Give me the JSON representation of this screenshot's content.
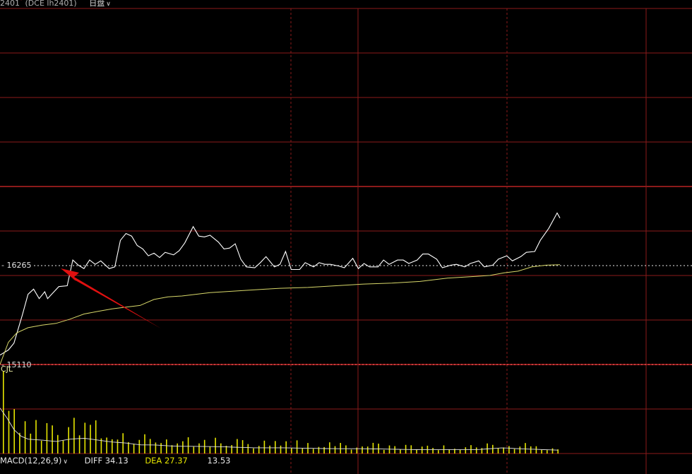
{
  "header": {
    "symbol_text": "2401",
    "star": "*",
    "contract_text": "(DCE lh2401)",
    "period_label": "日盘",
    "period_chevron": "chevron-down-icon"
  },
  "price_axis": {
    "upper_ref_label": "16265",
    "lower_ref_label": "15110"
  },
  "volume_panel": {
    "label": "CJL"
  },
  "macd": {
    "name": "MACD(12,26,9)",
    "chevron": "chevron-down-icon",
    "diff_label": "DIFF 34.13",
    "dea_label": "DEA 27.37",
    "macd_value": "13.53"
  },
  "colors": {
    "background": "#000000",
    "grid": "#8b1a1a",
    "price_line": "#ffffff",
    "avg_line": "#d8d86a",
    "ref_line_upper": "#e8e8e8",
    "ref_line_lower": "#ff6060",
    "volume_bar": "#e6e600",
    "annotation_arrow": "#e01010",
    "dea_text": "#e6e600"
  },
  "chart_data": {
    "type": "line",
    "panels": [
      "price",
      "volume",
      "macd"
    ],
    "price_range": [
      14980,
      17520
    ],
    "reference_lines": [
      16265,
      15110
    ],
    "series": [
      {
        "role": "price",
        "x": [
          0,
          3,
          5,
          8,
          10,
          12,
          14,
          16,
          17,
          19,
          21,
          24,
          26,
          28,
          30,
          32,
          34,
          36,
          39,
          41,
          43,
          45,
          47,
          49,
          51,
          53,
          55,
          57,
          59,
          62,
          64,
          66,
          69,
          71,
          73,
          75,
          78,
          80,
          82,
          84,
          86,
          88,
          91,
          93,
          95,
          98,
          100,
          102,
          104,
          107,
          109,
          112,
          114,
          116,
          118,
          121,
          123,
          126,
          128,
          130,
          132,
          135,
          137,
          139,
          142,
          144,
          146,
          149,
          151,
          153,
          156,
          158,
          161,
          163,
          166,
          168,
          171,
          173,
          176,
          178,
          181,
          183,
          186,
          188,
          191,
          193,
          196,
          199,
          200
        ],
        "values": [
          15220,
          15280,
          15360,
          15690,
          15930,
          15990,
          15880,
          15960,
          15880,
          15950,
          16020,
          16030,
          16330,
          16270,
          16230,
          16330,
          16280,
          16320,
          16230,
          16250,
          16560,
          16640,
          16610,
          16500,
          16460,
          16380,
          16410,
          16360,
          16420,
          16390,
          16440,
          16530,
          16720,
          16610,
          16600,
          16620,
          16540,
          16460,
          16470,
          16520,
          16340,
          16250,
          16240,
          16300,
          16370,
          16250,
          16280,
          16430,
          16220,
          16220,
          16300,
          16250,
          16300,
          16280,
          16280,
          16260,
          16240,
          16350,
          16230,
          16290,
          16250,
          16250,
          16330,
          16280,
          16330,
          16330,
          16290,
          16330,
          16400,
          16400,
          16340,
          16240,
          16270,
          16280,
          16250,
          16290,
          16320,
          16250,
          16270,
          16340,
          16380,
          16320,
          16370,
          16420,
          16430,
          16560,
          16700,
          16880,
          16820
        ],
        "note": "timeline price (white)"
      },
      {
        "role": "avg",
        "x": [
          0,
          3,
          6,
          10,
          15,
          20,
          25,
          30,
          35,
          40,
          45,
          50,
          55,
          60,
          65,
          70,
          75,
          80,
          85,
          90,
          95,
          100,
          110,
          120,
          130,
          140,
          150,
          160,
          170,
          175,
          180,
          185,
          190,
          195,
          200
        ],
        "values": [
          15110,
          15370,
          15480,
          15540,
          15570,
          15590,
          15640,
          15700,
          15730,
          15760,
          15780,
          15800,
          15870,
          15900,
          15910,
          15930,
          15950,
          15960,
          15970,
          15980,
          15990,
          16000,
          16010,
          16030,
          16050,
          16060,
          16080,
          16120,
          16140,
          16150,
          16180,
          16200,
          16250,
          16270,
          16275
        ],
        "note": "average price (yellow)"
      },
      {
        "role": "volume",
        "x": [
          0,
          3,
          6,
          10,
          15,
          20,
          25,
          30,
          35,
          40,
          45,
          50,
          55,
          60,
          65,
          70,
          80,
          90,
          100,
          110,
          120,
          130,
          140,
          150,
          160,
          170,
          175,
          180,
          185,
          190,
          195,
          200
        ],
        "values": [
          95,
          70,
          40,
          30,
          28,
          25,
          30,
          32,
          28,
          24,
          22,
          18,
          18,
          16,
          15,
          15,
          14,
          12,
          12,
          11,
          10,
          10,
          9,
          8,
          8,
          8,
          10,
          12,
          10,
          9,
          8,
          7
        ],
        "note": "volume (approx relative units)"
      }
    ]
  }
}
